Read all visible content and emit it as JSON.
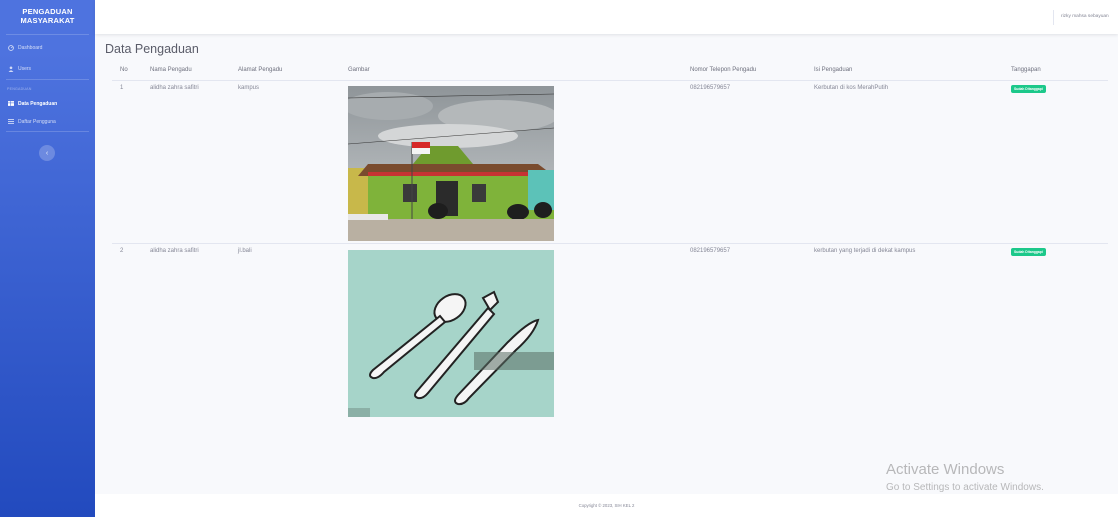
{
  "sidebar": {
    "brand_line1": "PENGADUAN",
    "brand_line2": "MASYARAKAT",
    "heading": "PENGADUAN",
    "items": [
      {
        "label": "Dashboard",
        "icon": "dashboard-icon"
      },
      {
        "label": "Users",
        "icon": "user-icon"
      },
      {
        "label": "Data Pengaduan",
        "icon": "table-icon"
      },
      {
        "label": "Daftar Pengguna",
        "icon": "list-icon"
      }
    ],
    "toggle_glyph": "‹"
  },
  "topbar": {
    "user_name": "rizky mahsa sebayuan"
  },
  "page": {
    "title": "Data Pengaduan"
  },
  "table": {
    "headers": [
      "No",
      "Nama Pengadu",
      "Alamat Pengadu",
      "Gambar",
      "Nomor Telepon Pengadu",
      "Isi Pengaduan",
      "Tanggapan"
    ],
    "rows": [
      {
        "no": "1",
        "nama": "alidha zahra safitri",
        "alamat": "kampus",
        "telepon": "082196579657",
        "isi": "Kerbutan di kos MerahPutih",
        "tanggapan": "Sudah Ditanggapi"
      },
      {
        "no": "2",
        "nama": "alidha zahra safitri",
        "alamat": "jl.bali",
        "telepon": "082196579657",
        "isi": "kerbutan yang terjadi di dekat kampus",
        "tanggapan": "Sudah Ditanggapi"
      }
    ]
  },
  "footer": {
    "copyright": "Copyright © 2023, SIH KEL 2"
  },
  "watermark": {
    "line1": "Activate Windows",
    "line2": "Go to Settings to activate Windows."
  },
  "colors": {
    "primary": "#4e73df",
    "primary_dark": "#224abe",
    "success": "#1cc88a",
    "text_muted": "#858796"
  }
}
